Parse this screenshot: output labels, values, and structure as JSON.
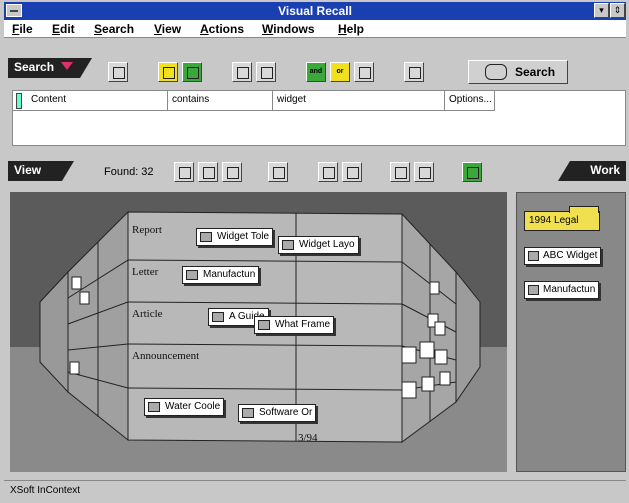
{
  "app": {
    "title": "Visual Recall"
  },
  "menu": [
    "File",
    "Edit",
    "Search",
    "View",
    "Actions",
    "Windows",
    "Help"
  ],
  "search": {
    "section_label": "Search",
    "button_label": "Search",
    "query": {
      "field": "Content",
      "operator": "contains",
      "value": "widget",
      "options": "Options..."
    }
  },
  "view": {
    "section_label": "View",
    "found": "Found: 32",
    "rows": [
      "Report",
      "Letter",
      "Article",
      "Announcement"
    ],
    "date_label": "3/94",
    "documents": [
      "Widget Tole",
      "Widget Layo",
      "Manufactun",
      "A Guide",
      "What Frame",
      "Water Coole",
      "Software Or"
    ]
  },
  "work": {
    "section_label": "Work",
    "folder": "1994 Legal",
    "items": [
      "ABC Widget",
      "Manufactun"
    ]
  },
  "status": "XSoft InContext",
  "colors": {
    "titlebar": "#1a3fb0",
    "and_button": "#3aa83a",
    "or_button": "#f0e020",
    "folder": "#f0e050"
  }
}
